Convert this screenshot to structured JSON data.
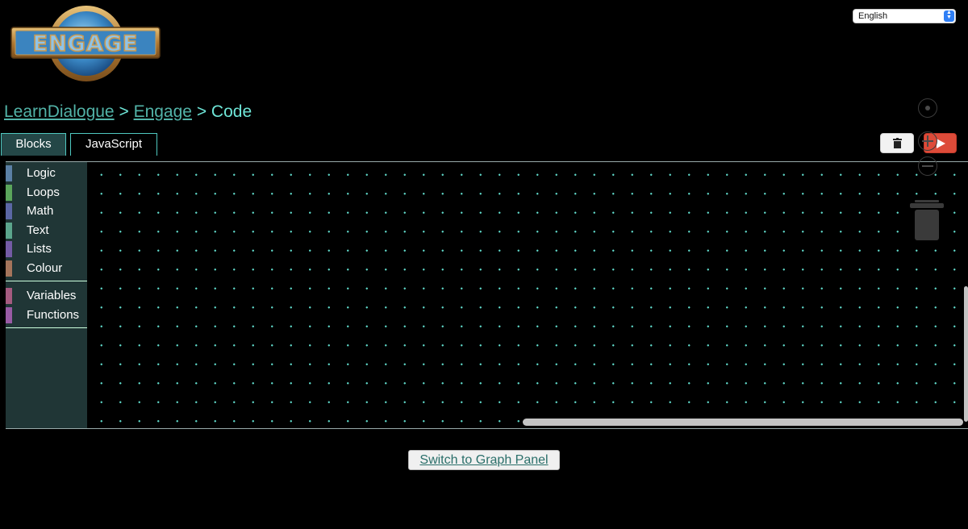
{
  "logo": {
    "text": "ENGAGE"
  },
  "language": {
    "selected": "English"
  },
  "breadcrumb": {
    "items": [
      "LearnDialogue",
      "Engage"
    ],
    "separator": ">",
    "current": "Code"
  },
  "tabs": [
    {
      "label": "Blocks",
      "active": false
    },
    {
      "label": "JavaScript",
      "active": true
    }
  ],
  "toolbox": {
    "groups": [
      [
        {
          "label": "Logic",
          "color": "#5b80a5"
        },
        {
          "label": "Loops",
          "color": "#5ba55b"
        },
        {
          "label": "Math",
          "color": "#5b67a5"
        },
        {
          "label": "Text",
          "color": "#5ba58c"
        },
        {
          "label": "Lists",
          "color": "#745ba5"
        },
        {
          "label": "Colour",
          "color": "#a5745b"
        }
      ],
      [
        {
          "label": "Variables",
          "color": "#a55b80"
        },
        {
          "label": "Functions",
          "color": "#995ba5"
        }
      ]
    ]
  },
  "colors": {
    "accent": "#6fe6d8",
    "link": "#52b3a8",
    "run": "#dd4b39",
    "toolbox_bg": "#203636",
    "grid_dot": "#5ed6c6"
  },
  "footer": {
    "switch_label": "Switch to Graph Panel"
  }
}
